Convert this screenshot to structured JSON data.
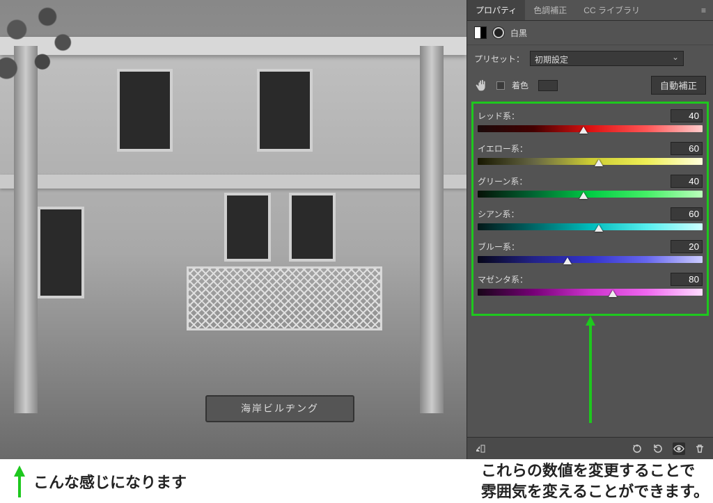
{
  "tabs": {
    "properties": "プロパティ",
    "color_correction": "色調補正",
    "cc_libraries": "CC ライブラリ"
  },
  "adjustment": {
    "name": "白黒"
  },
  "preset": {
    "label": "プリセット：",
    "value": "初期設定"
  },
  "tint": {
    "label": "着色"
  },
  "auto_button": "自動補正",
  "sliders": [
    {
      "label": "レッド系：",
      "value": "40",
      "gradient": "grad-red",
      "pos": 47
    },
    {
      "label": "イエロー系：",
      "value": "60",
      "gradient": "grad-yellow",
      "pos": 54
    },
    {
      "label": "グリーン系：",
      "value": "40",
      "gradient": "grad-green",
      "pos": 47
    },
    {
      "label": "シアン系：",
      "value": "60",
      "gradient": "grad-cyan",
      "pos": 54
    },
    {
      "label": "ブルー系：",
      "value": "20",
      "gradient": "grad-blue",
      "pos": 40
    },
    {
      "label": "マゼンタ系：",
      "value": "80",
      "gradient": "grad-magenta",
      "pos": 60
    }
  ],
  "image_sign": "海岸ビルヂング",
  "captions": {
    "left": "こんな感じになります",
    "right_line1": "これらの数値を変更することで",
    "right_line2": "雰囲気を変えることができます。"
  },
  "slider_range": {
    "min": -200,
    "max": 300
  }
}
